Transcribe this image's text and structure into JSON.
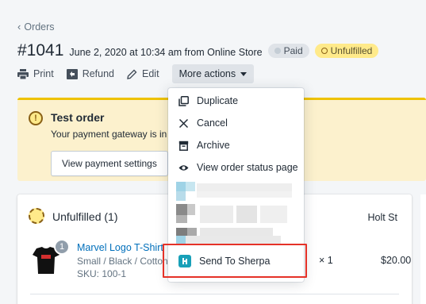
{
  "breadcrumb": {
    "label": "Orders"
  },
  "order": {
    "number": "#1041",
    "meta": "June 2, 2020 at 10:34 am from Online Store",
    "payment_badge": "Paid",
    "fulfillment_badge": "Unfulfilled"
  },
  "actions": {
    "print": "Print",
    "refund": "Refund",
    "edit": "Edit",
    "more": "More actions"
  },
  "banner": {
    "title": "Test order",
    "text": "Your payment gateway is in t",
    "button": "View payment settings"
  },
  "fulfillment_card": {
    "title": "Unfulfilled (1)",
    "location": "Holt St",
    "item": {
      "quantity_badge": "1",
      "name": "Marvel Logo T-Shirt",
      "variant": "Small / Black / Cotton",
      "sku": "SKU: 100-1",
      "qty": "× 1",
      "total": "$20.00"
    }
  },
  "more_actions_menu": {
    "items": [
      {
        "label": "Duplicate",
        "icon": "duplicate-icon"
      },
      {
        "label": "Cancel",
        "icon": "close-icon"
      },
      {
        "label": "Archive",
        "icon": "archive-icon"
      },
      {
        "label": "View order status page",
        "icon": "eye-icon"
      },
      {
        "label": "Send To Sherpa",
        "icon": "sherpa-app-icon"
      }
    ]
  },
  "colors": {
    "link": "#006fbb",
    "warning_bg": "#fcf1cd",
    "warning_border": "#eec200",
    "badge_unfulfilled": "#ffea8a",
    "highlight": "#e53228",
    "sherpa": "#18a0b8"
  }
}
